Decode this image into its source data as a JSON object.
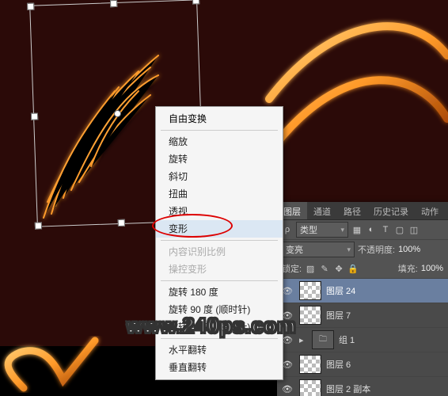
{
  "menu": {
    "title": "自由变换",
    "items": [
      "缩放",
      "旋转",
      "斜切",
      "扭曲",
      "透视",
      "变形",
      "内容识别比例",
      "操控变形",
      "旋转 180 度",
      "旋转 90 度 (顺时针)",
      "旋转 90 度 (逆时针)",
      "水平翻转",
      "垂直翻转"
    ],
    "highlighted": "变形",
    "disabled": [
      "内容识别比例",
      "操控变形"
    ]
  },
  "panel": {
    "tabs": [
      "图层",
      "通道",
      "路径",
      "历史记录",
      "动作"
    ],
    "active_tab": "图层",
    "kind_label": "类型",
    "blend_mode": "变亮",
    "opacity_label": "不透明度:",
    "opacity_value": "100%",
    "lock_label": "锁定:",
    "fill_label": "填充:",
    "fill_value": "100%",
    "layers": [
      {
        "name": "图层 24",
        "selected": true,
        "thumb": "checker",
        "visible": true
      },
      {
        "name": "图层 7",
        "selected": false,
        "thumb": "checker",
        "visible": true
      },
      {
        "name": "组 1",
        "selected": false,
        "thumb": "folder",
        "visible": true
      },
      {
        "name": "图层 6",
        "selected": false,
        "thumb": "checker",
        "visible": true
      },
      {
        "name": "图层 2 副本",
        "selected": false,
        "thumb": "checker",
        "visible": true
      }
    ]
  },
  "watermark": "www.240ps.com",
  "icons": {
    "eye": "👁",
    "chevron": "▾",
    "folder": "▸ ▮",
    "kind": "ρ",
    "search": "⌕"
  }
}
